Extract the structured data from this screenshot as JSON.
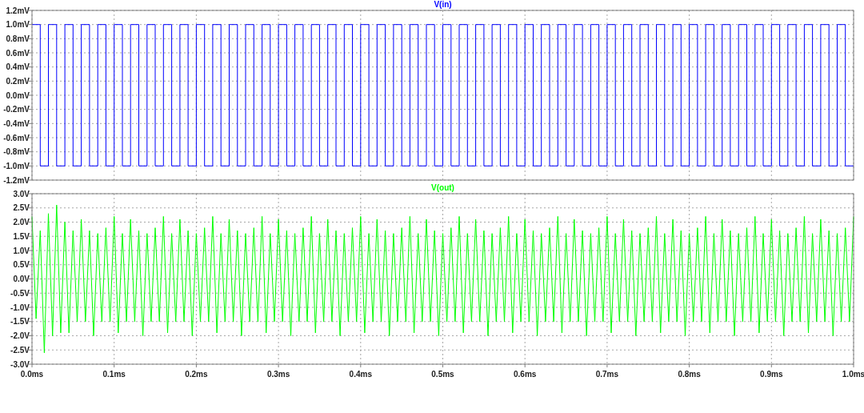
{
  "charts": [
    {
      "chart_data": {
        "type": "line",
        "grid": true,
        "xlim": [
          0,
          1
        ],
        "ylim": [
          -1.2,
          1.2
        ],
        "yticks": [
          {
            "value": 1.2,
            "label": "1.2mV"
          },
          {
            "value": 1.0,
            "label": "1.0mV"
          },
          {
            "value": 0.8,
            "label": "0.8mV"
          },
          {
            "value": 0.6,
            "label": "0.6mV"
          },
          {
            "value": 0.4,
            "label": "0.4mV"
          },
          {
            "value": 0.2,
            "label": "0.2mV"
          },
          {
            "value": 0,
            "label": "0.0mV"
          },
          {
            "value": -0.2,
            "label": "-0.2mV"
          },
          {
            "value": -0.4,
            "label": "-0.4mV"
          },
          {
            "value": -0.6,
            "label": "-0.6mV"
          },
          {
            "value": -0.8,
            "label": "-0.8mV"
          },
          {
            "value": -1.0,
            "label": "-1.0mV"
          },
          {
            "value": -1.2,
            "label": "-1.2mV"
          }
        ],
        "x": [
          0,
          0.01,
          0.01,
          0.02,
          0.02,
          0.03,
          0.03,
          0.04,
          0.04,
          0.05,
          0.05,
          0.06,
          0.06,
          0.07,
          0.07,
          0.08,
          0.08,
          0.09,
          0.09,
          0.1,
          0.1,
          0.11,
          0.11,
          0.12,
          0.12,
          0.13,
          0.13,
          0.14,
          0.14,
          0.15,
          0.15,
          0.16,
          0.16,
          0.17,
          0.17,
          0.18,
          0.18,
          0.19,
          0.19,
          0.2,
          0.2,
          0.21,
          0.21,
          0.22,
          0.22,
          0.23,
          0.23,
          0.24,
          0.24,
          0.25,
          0.25,
          0.26,
          0.26,
          0.27,
          0.27,
          0.28,
          0.28,
          0.29,
          0.29,
          0.3,
          0.3,
          0.31,
          0.31,
          0.32,
          0.32,
          0.33,
          0.33,
          0.34,
          0.34,
          0.35,
          0.35,
          0.36,
          0.36,
          0.37,
          0.37,
          0.38,
          0.38,
          0.39,
          0.39,
          0.4,
          0.4,
          0.41,
          0.41,
          0.42,
          0.42,
          0.43,
          0.43,
          0.44,
          0.44,
          0.45,
          0.45,
          0.46,
          0.46,
          0.47,
          0.47,
          0.48,
          0.48,
          0.49,
          0.49,
          0.5,
          0.5,
          0.51,
          0.51,
          0.52,
          0.52,
          0.53,
          0.53,
          0.54,
          0.54,
          0.55,
          0.55,
          0.56,
          0.56,
          0.57,
          0.57,
          0.58,
          0.58,
          0.59,
          0.59,
          0.6,
          0.6,
          0.61,
          0.61,
          0.62,
          0.62,
          0.63,
          0.63,
          0.64,
          0.64,
          0.65,
          0.65,
          0.66,
          0.66,
          0.67,
          0.67,
          0.68,
          0.68,
          0.69,
          0.69,
          0.7,
          0.7,
          0.71,
          0.71,
          0.72,
          0.72,
          0.73,
          0.73,
          0.74,
          0.74,
          0.75,
          0.75,
          0.76,
          0.76,
          0.77,
          0.77,
          0.78,
          0.78,
          0.79,
          0.79,
          0.8,
          0.8,
          0.81,
          0.81,
          0.82,
          0.82,
          0.83,
          0.83,
          0.84,
          0.84,
          0.85,
          0.85,
          0.86,
          0.86,
          0.87,
          0.87,
          0.88,
          0.88,
          0.89,
          0.89,
          0.9,
          0.9,
          0.91,
          0.91,
          0.92,
          0.92,
          0.93,
          0.93,
          0.94,
          0.94,
          0.95,
          0.95,
          0.96,
          0.96,
          0.97,
          0.97,
          0.98,
          0.98,
          0.99,
          0.99,
          1
        ],
        "series": [
          {
            "name": "V(in)",
            "color": "#0000ff",
            "values": [
              1,
              1,
              -1,
              -1,
              1,
              1,
              -1,
              -1,
              1,
              1,
              -1,
              -1,
              1,
              1,
              -1,
              -1,
              1,
              1,
              -1,
              -1,
              1,
              1,
              -1,
              -1,
              1,
              1,
              -1,
              -1,
              1,
              1,
              -1,
              -1,
              1,
              1,
              -1,
              -1,
              1,
              1,
              -1,
              -1,
              1,
              1,
              -1,
              -1,
              1,
              1,
              -1,
              -1,
              1,
              1,
              -1,
              -1,
              1,
              1,
              -1,
              -1,
              1,
              1,
              -1,
              -1,
              1,
              1,
              -1,
              -1,
              1,
              1,
              -1,
              -1,
              1,
              1,
              -1,
              -1,
              1,
              1,
              -1,
              -1,
              1,
              1,
              -1,
              -1,
              1,
              1,
              -1,
              -1,
              1,
              1,
              -1,
              -1,
              1,
              1,
              -1,
              -1,
              1,
              1,
              -1,
              -1,
              1,
              1,
              -1,
              -1,
              1,
              1,
              -1,
              -1,
              1,
              1,
              -1,
              -1,
              1,
              1,
              -1,
              -1,
              1,
              1,
              -1,
              -1,
              1,
              1,
              -1,
              -1,
              1,
              1,
              -1,
              -1,
              1,
              1,
              -1,
              -1,
              1,
              1,
              -1,
              -1,
              1,
              1,
              -1,
              -1,
              1,
              1,
              -1,
              -1,
              1,
              1,
              -1,
              -1,
              1,
              1,
              -1,
              -1,
              1,
              1,
              -1,
              -1,
              1,
              1,
              -1,
              -1,
              1,
              1,
              -1,
              -1,
              1,
              1,
              -1,
              -1,
              1,
              1,
              -1,
              -1,
              1,
              1,
              -1,
              -1,
              1,
              1,
              -1,
              -1,
              1,
              1,
              -1,
              -1,
              1,
              1,
              -1,
              -1,
              1,
              1,
              -1,
              -1,
              1,
              1,
              -1,
              -1,
              1,
              1,
              -1,
              -1,
              1,
              1,
              -1,
              -1
            ]
          }
        ]
      }
    },
    {
      "chart_data": {
        "type": "line",
        "grid": true,
        "xlim": [
          0,
          1
        ],
        "ylim": [
          -3,
          3
        ],
        "x": [
          0,
          0.005,
          0.01,
          0.015,
          0.02,
          0.025,
          0.03,
          0.035,
          0.04,
          0.045,
          0.05,
          0.055,
          0.06,
          0.065,
          0.07,
          0.075,
          0.08,
          0.085,
          0.09,
          0.095,
          0.1,
          0.105,
          0.11,
          0.115,
          0.12,
          0.125,
          0.13,
          0.135,
          0.14,
          0.145,
          0.15,
          0.155,
          0.16,
          0.165,
          0.17,
          0.175,
          0.18,
          0.185,
          0.19,
          0.195,
          0.2,
          0.205,
          0.21,
          0.215,
          0.22,
          0.225,
          0.23,
          0.235,
          0.24,
          0.245,
          0.25,
          0.255,
          0.26,
          0.265,
          0.27,
          0.275,
          0.28,
          0.285,
          0.29,
          0.295,
          0.3,
          0.305,
          0.31,
          0.315,
          0.32,
          0.325,
          0.33,
          0.335,
          0.34,
          0.345,
          0.35,
          0.355,
          0.36,
          0.365,
          0.37,
          0.375,
          0.38,
          0.385,
          0.39,
          0.395,
          0.4,
          0.405,
          0.41,
          0.415,
          0.42,
          0.425,
          0.43,
          0.435,
          0.44,
          0.445,
          0.45,
          0.455,
          0.46,
          0.465,
          0.47,
          0.475,
          0.48,
          0.485,
          0.49,
          0.495,
          0.5,
          0.505,
          0.51,
          0.515,
          0.52,
          0.525,
          0.53,
          0.535,
          0.54,
          0.545,
          0.55,
          0.555,
          0.56,
          0.565,
          0.57,
          0.575,
          0.58,
          0.585,
          0.59,
          0.595,
          0.6,
          0.605,
          0.61,
          0.615,
          0.62,
          0.625,
          0.63,
          0.635,
          0.64,
          0.645,
          0.65,
          0.655,
          0.66,
          0.665,
          0.67,
          0.675,
          0.68,
          0.685,
          0.69,
          0.695,
          0.7,
          0.705,
          0.71,
          0.715,
          0.72,
          0.725,
          0.73,
          0.735,
          0.74,
          0.745,
          0.75,
          0.755,
          0.76,
          0.765,
          0.77,
          0.775,
          0.78,
          0.785,
          0.79,
          0.795,
          0.8,
          0.805,
          0.81,
          0.815,
          0.82,
          0.825,
          0.83,
          0.835,
          0.84,
          0.845,
          0.85,
          0.855,
          0.86,
          0.865,
          0.87,
          0.875,
          0.88,
          0.885,
          0.89,
          0.895,
          0.9,
          0.905,
          0.91,
          0.915,
          0.92,
          0.925,
          0.93,
          0.935,
          0.94,
          0.945,
          0.95,
          0.955,
          0.96,
          0.965,
          0.97,
          0.975,
          0.98,
          0.985,
          0.99,
          0.995,
          1
        ],
        "xticks": [
          {
            "value": 0,
            "label": "0.0ms"
          },
          {
            "value": 0.1,
            "label": "0.1ms"
          },
          {
            "value": 0.2,
            "label": "0.2ms"
          },
          {
            "value": 0.3,
            "label": "0.3ms"
          },
          {
            "value": 0.4,
            "label": "0.4ms"
          },
          {
            "value": 0.5,
            "label": "0.5ms"
          },
          {
            "value": 0.6,
            "label": "0.6ms"
          },
          {
            "value": 0.7,
            "label": "0.7ms"
          },
          {
            "value": 0.8,
            "label": "0.8ms"
          },
          {
            "value": 0.9,
            "label": "0.9ms"
          },
          {
            "value": 1.0,
            "label": "1.0ms"
          }
        ],
        "yticks": [
          {
            "value": 3,
            "label": "3.0V"
          },
          {
            "value": 2.5,
            "label": "2.5V"
          },
          {
            "value": 2,
            "label": "2.0V"
          },
          {
            "value": 1.5,
            "label": "1.5V"
          },
          {
            "value": 1,
            "label": "1.0V"
          },
          {
            "value": 0.5,
            "label": "0.5V"
          },
          {
            "value": 0,
            "label": "0.0V"
          },
          {
            "value": -0.5,
            "label": "-0.5V"
          },
          {
            "value": -1,
            "label": "-1.0V"
          },
          {
            "value": -1.5,
            "label": "-1.5V"
          },
          {
            "value": -2,
            "label": "-2.0V"
          },
          {
            "value": -2.5,
            "label": "-2.5V"
          },
          {
            "value": -3,
            "label": "-3.0V"
          }
        ],
        "series": [
          {
            "name": "V(out)",
            "color": "#00ff00",
            "values": [
              2.2,
              -1.4,
              1.7,
              -2.6,
              2.3,
              -2.0,
              2.6,
              -1.9,
              2.0,
              -1.9,
              1.7,
              -1.5,
              2.1,
              -1.5,
              1.7,
              -2.0,
              1.6,
              -1.5,
              1.8,
              -1.5,
              2.2,
              -1.9,
              1.6,
              -1.5,
              2.1,
              -1.5,
              1.7,
              -2.0,
              1.6,
              -1.5,
              1.8,
              -1.5,
              2.2,
              -1.9,
              1.6,
              -1.5,
              2.1,
              -1.5,
              1.7,
              -2.0,
              1.6,
              -1.5,
              1.8,
              -1.5,
              2.2,
              -1.9,
              1.6,
              -1.5,
              2.1,
              -1.5,
              1.7,
              -2.0,
              1.6,
              -1.5,
              1.8,
              -1.5,
              2.2,
              -1.9,
              1.6,
              -1.5,
              2.1,
              -1.5,
              1.7,
              -2.0,
              1.6,
              -1.5,
              1.8,
              -1.5,
              2.2,
              -1.9,
              1.6,
              -1.5,
              2.1,
              -1.5,
              1.7,
              -2.0,
              1.6,
              -1.5,
              1.8,
              -1.5,
              2.2,
              -1.9,
              1.6,
              -1.5,
              2.1,
              -1.5,
              1.7,
              -2.0,
              1.6,
              -1.5,
              1.8,
              -1.5,
              2.2,
              -1.9,
              1.6,
              -1.5,
              2.1,
              -1.5,
              1.7,
              -2.0,
              1.6,
              -1.5,
              1.8,
              -1.5,
              2.2,
              -1.9,
              1.6,
              -1.5,
              2.1,
              -1.5,
              1.7,
              -2.0,
              1.6,
              -1.5,
              1.8,
              -1.5,
              2.2,
              -1.9,
              1.6,
              -1.5,
              2.1,
              -1.5,
              1.7,
              -2.0,
              1.6,
              -1.5,
              1.8,
              -1.5,
              2.2,
              -1.9,
              1.6,
              -1.5,
              2.1,
              -1.5,
              1.7,
              -2.0,
              1.6,
              -1.5,
              1.8,
              -1.5,
              2.2,
              -1.9,
              1.6,
              -1.5,
              2.1,
              -1.5,
              1.7,
              -2.0,
              1.6,
              -1.5,
              1.8,
              -1.5,
              2.2,
              -1.9,
              1.6,
              -1.5,
              2.1,
              -1.5,
              1.7,
              -2.0,
              1.6,
              -1.5,
              1.8,
              -1.5,
              2.2,
              -1.9,
              1.6,
              -1.5,
              2.1,
              -1.5,
              1.7,
              -2.0,
              1.6,
              -1.5,
              1.8,
              -1.5,
              2.2,
              -1.9,
              1.6,
              -1.5,
              2.1,
              -1.5,
              1.7,
              -2.0,
              1.6,
              -1.5,
              1.8,
              -1.5,
              2.2,
              -1.9,
              1.6,
              -1.5,
              2.1,
              -1.5,
              1.7,
              -2.0,
              1.6,
              -1.5,
              1.8,
              -1.5,
              2.2
            ]
          }
        ]
      }
    }
  ]
}
